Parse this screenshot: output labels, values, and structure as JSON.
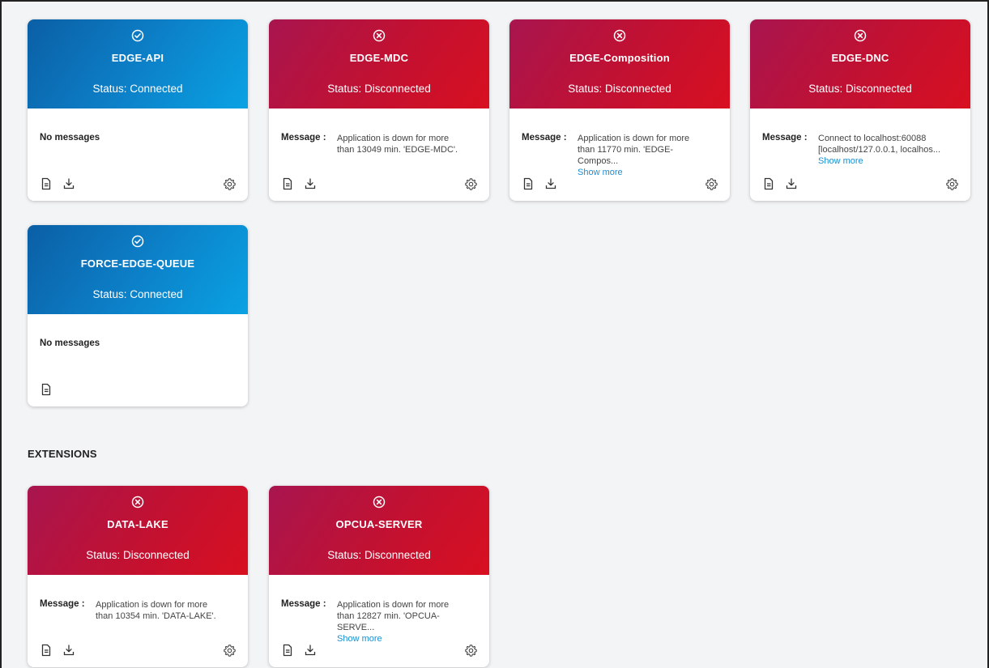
{
  "section_extensions": "EXTENSIONS",
  "labels": {
    "message": "Message :",
    "no_messages": "No messages",
    "show_more": "Show more"
  },
  "colors": {
    "connected": "#0c7fc7",
    "disconnected": "#c01133",
    "link": "#1a8fd0"
  },
  "cards": [
    {
      "name": "EDGE-API",
      "status": "Status: Connected",
      "state": "connected",
      "icon": "check-circle-icon",
      "message": null,
      "show_more": false
    },
    {
      "name": "EDGE-MDC",
      "status": "Status: Disconnected",
      "state": "disconnected",
      "icon": "x-circle-icon",
      "message": [
        "Application is down for more",
        "than 13049 min. 'EDGE-MDC'."
      ],
      "show_more": false
    },
    {
      "name": "EDGE-Composition",
      "status": "Status: Disconnected",
      "state": "disconnected",
      "icon": "x-circle-icon",
      "message": [
        "Application is down for more",
        "than 11770 min. 'EDGE-",
        "Compos..."
      ],
      "show_more": true
    },
    {
      "name": "EDGE-DNC",
      "status": "Status: Disconnected",
      "state": "disconnected",
      "icon": "x-circle-icon",
      "message": [
        "Connect to localhost:60088",
        "[localhost/127.0.0.1, localhos..."
      ],
      "show_more": true
    },
    {
      "name": "FORCE-EDGE-QUEUE",
      "status": "Status: Connected",
      "state": "connected",
      "icon": "check-circle-icon",
      "message": null,
      "show_more": false
    },
    {
      "name": "DATA-LAKE",
      "status": "Status: Disconnected",
      "state": "disconnected",
      "icon": "x-circle-icon",
      "message": [
        "Application is down for more",
        "than 10354 min. 'DATA-LAKE'."
      ],
      "show_more": false
    },
    {
      "name": "OPCUA-SERVER",
      "status": "Status: Disconnected",
      "state": "disconnected",
      "icon": "x-circle-icon",
      "message": [
        "Application is down for more",
        "than 12827 min. 'OPCUA-",
        "SERVE..."
      ],
      "show_more": true
    }
  ]
}
